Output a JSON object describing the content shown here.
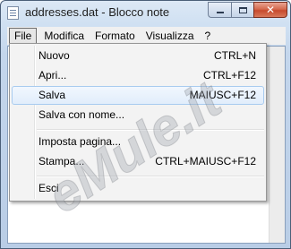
{
  "window": {
    "title": "addresses.dat - Blocco note",
    "controls": {
      "minimize": "minimize-icon",
      "maximize": "maximize-icon",
      "close": "close-icon",
      "close_glyph": "✕"
    }
  },
  "menubar": {
    "items": [
      {
        "label": "File"
      },
      {
        "label": "Modifica"
      },
      {
        "label": "Formato"
      },
      {
        "label": "Visualizza"
      },
      {
        "label": "?"
      }
    ]
  },
  "file_menu": {
    "items": [
      {
        "label": "Nuovo",
        "shortcut": "CTRL+N"
      },
      {
        "label": "Apri...",
        "shortcut": "CTRL+F12"
      },
      {
        "label": "Salva",
        "shortcut": "MAIUSC+F12"
      },
      {
        "label": "Salva con nome...",
        "shortcut": ""
      },
      {
        "label": "Imposta pagina...",
        "shortcut": ""
      },
      {
        "label": "Stampa...",
        "shortcut": "CTRL+MAIUSC+F12"
      },
      {
        "label": "Esci",
        "shortcut": ""
      }
    ]
  },
  "watermark": {
    "text": "eMule.it"
  },
  "colors": {
    "highlight_border": "#a8cbef",
    "watermark": "#9aa0a8",
    "close_button": "#c74a2d"
  }
}
